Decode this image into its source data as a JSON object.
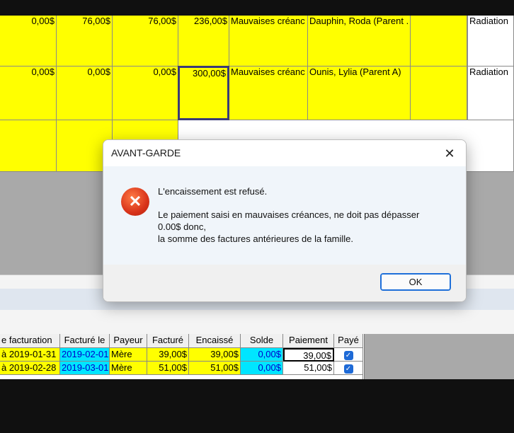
{
  "grid_rows": [
    {
      "c1": "0,00$",
      "c2": "76,00$",
      "c3": "76,00$",
      "c4": "236,00$",
      "reason": "Mauvaises créanc",
      "name": "Dauphin, Roda (Parent .",
      "status": "Radiation"
    },
    {
      "c1": "0,00$",
      "c2": "0,00$",
      "c3": "0,00$",
      "c4": "300,00$",
      "reason": "Mauvaises créanc",
      "name": "Ounis, Lylia (Parent A)",
      "status": "Radiation"
    }
  ],
  "dialog": {
    "title": "AVANT-GARDE",
    "close_icon": "close-icon",
    "error_icon": "error-icon",
    "line1": "L'encaissement est refusé.",
    "line2": "Le paiement saisi en mauvaises créances, ne doit pas dépasser",
    "line3": "0.00$ donc,",
    "line4": "la somme des factures antérieures de la famille.",
    "ok_label": "OK"
  },
  "billing_table": {
    "headers": [
      "e facturation",
      "Facturé le",
      "Payeur",
      "Facturé",
      "Encaissé",
      "Solde",
      "Paiement",
      "Payé"
    ],
    "rows": [
      {
        "period": "à 2019-01-31",
        "billed_on": "2019-02-01",
        "payer": "Mère",
        "billed": "39,00$",
        "collected": "39,00$",
        "balance": "0,00$",
        "payment": "39,00$",
        "paid": true
      },
      {
        "period": "à 2019-02-28",
        "billed_on": "2019-03-01",
        "payer": "Mère",
        "billed": "51,00$",
        "collected": "51,00$",
        "balance": "0,00$",
        "payment": "51,00$",
        "paid": true
      }
    ]
  },
  "colors": {
    "highlight": "#ffff00",
    "cyan": "#00e5ff",
    "accent": "#1e6fd9",
    "error": "#d8331a"
  }
}
